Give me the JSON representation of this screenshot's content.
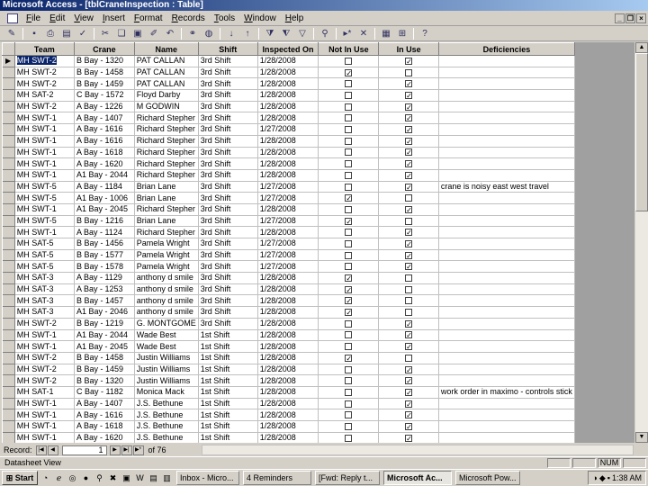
{
  "window": {
    "title": "Microsoft Access - [tblCraneInspection : Table]"
  },
  "menu": [
    "File",
    "Edit",
    "View",
    "Insert",
    "Format",
    "Records",
    "Tools",
    "Window",
    "Help"
  ],
  "toolbar_icons": [
    "design-view-icon",
    "save-icon",
    "print-icon",
    "print-preview-icon",
    "spelling-icon",
    "cut-icon",
    "copy-icon",
    "paste-icon",
    "format-painter-icon",
    "undo-icon",
    "insert-hyperlink-icon",
    "web-toolbar-icon",
    "sort-ascending-icon",
    "sort-descending-icon",
    "filter-by-selection-icon",
    "filter-by-form-icon",
    "apply-filter-icon",
    "find-icon",
    "new-record-icon",
    "delete-record-icon",
    "database-window-icon",
    "new-object-icon",
    "help-icon"
  ],
  "columns": [
    "Team",
    "Crane",
    "Name",
    "Shift",
    "Inspected On",
    "Not In Use",
    "In Use",
    "Deficiencies"
  ],
  "rows": [
    [
      "MH SWT-2",
      "B Bay - 1320",
      "PAT CALLAN",
      "3rd Shift",
      "1/28/2008",
      false,
      true,
      ""
    ],
    [
      "MH SWT-2",
      "B Bay - 1458",
      "PAT CALLAN",
      "3rd Shift",
      "1/28/2008",
      true,
      false,
      ""
    ],
    [
      "MH SWT-2",
      "B Bay - 1459",
      "PAT CALLAN",
      "3rd Shift",
      "1/28/2008",
      false,
      true,
      ""
    ],
    [
      "MH SAT-2",
      "C Bay - 1572",
      "Floyd Darby",
      "3rd Shift",
      "1/28/2008",
      false,
      true,
      ""
    ],
    [
      "MH SWT-2",
      "A Bay - 1226",
      "M GODWIN",
      "3rd Shift",
      "1/28/2008",
      false,
      true,
      ""
    ],
    [
      "MH SWT-1",
      "A Bay - 1407",
      "Richard Stepher",
      "3rd Shift",
      "1/28/2008",
      false,
      true,
      ""
    ],
    [
      "MH SWT-1",
      "A Bay - 1616",
      "Richard Stepher",
      "3rd Shift",
      "1/27/2008",
      false,
      true,
      ""
    ],
    [
      "MH SWT-1",
      "A Bay - 1616",
      "Richard Stepher",
      "3rd Shift",
      "1/28/2008",
      false,
      true,
      ""
    ],
    [
      "MH SWT-1",
      "A Bay - 1618",
      "Richard Stepher",
      "3rd Shift",
      "1/28/2008",
      false,
      true,
      ""
    ],
    [
      "MH SWT-1",
      "A Bay - 1620",
      "Richard Stepher",
      "3rd Shift",
      "1/28/2008",
      false,
      true,
      ""
    ],
    [
      "MH SWT-1",
      "A1 Bay - 2044",
      "Richard Stepher",
      "3rd Shift",
      "1/28/2008",
      false,
      true,
      ""
    ],
    [
      "MH SWT-5",
      "A Bay - 1184",
      "Brian Lane",
      "3rd Shift",
      "1/27/2008",
      false,
      true,
      "crane is noisy east west travel"
    ],
    [
      "MH SWT-5",
      "A1 Bay - 1006",
      "Brian Lane",
      "3rd Shift",
      "1/27/2008",
      true,
      false,
      ""
    ],
    [
      "MH SWT-1",
      "A1 Bay - 2045",
      "Richard Stepher",
      "3rd Shift",
      "1/28/2008",
      false,
      true,
      ""
    ],
    [
      "MH SWT-5",
      "B Bay - 1216",
      "Brian Lane",
      "3rd Shift",
      "1/27/2008",
      true,
      false,
      ""
    ],
    [
      "MH SWT-1",
      "A Bay - 1124",
      "Richard Stepher",
      "3rd Shift",
      "1/28/2008",
      false,
      true,
      ""
    ],
    [
      "MH SAT-5",
      "B Bay - 1456",
      "Pamela Wright",
      "3rd Shift",
      "1/27/2008",
      false,
      true,
      ""
    ],
    [
      "MH SAT-5",
      "B Bay - 1577",
      "Pamela Wright",
      "3rd Shift",
      "1/27/2008",
      false,
      true,
      ""
    ],
    [
      "MH SAT-5",
      "B Bay - 1578",
      "Pamela Wright",
      "3rd Shift",
      "1/27/2008",
      false,
      true,
      ""
    ],
    [
      "MH SAT-3",
      "A Bay - 1129",
      "anthony d smile",
      "3rd Shift",
      "1/28/2008",
      true,
      false,
      ""
    ],
    [
      "MH SAT-3",
      "A Bay - 1253",
      "anthony d smile",
      "3rd Shift",
      "1/28/2008",
      true,
      false,
      ""
    ],
    [
      "MH SAT-3",
      "B Bay - 1457",
      "anthony d smile",
      "3rd Shift",
      "1/28/2008",
      true,
      false,
      ""
    ],
    [
      "MH SAT-3",
      "A1 Bay - 2046",
      "anthony d smile",
      "3rd Shift",
      "1/28/2008",
      true,
      false,
      ""
    ],
    [
      "MH SWT-2",
      "B Bay - 1219",
      "G. MONTGOME",
      "3rd Shift",
      "1/28/2008",
      false,
      true,
      ""
    ],
    [
      "MH SWT-1",
      "A1 Bay - 2044",
      "Wade Best",
      "1st Shift",
      "1/28/2008",
      false,
      true,
      ""
    ],
    [
      "MH SWT-1",
      "A1 Bay - 2045",
      "Wade Best",
      "1st Shift",
      "1/28/2008",
      false,
      true,
      ""
    ],
    [
      "MH SWT-2",
      "B Bay - 1458",
      "Justin Williams",
      "1st Shift",
      "1/28/2008",
      true,
      false,
      ""
    ],
    [
      "MH SWT-2",
      "B Bay - 1459",
      "Justin Williams",
      "1st Shift",
      "1/28/2008",
      false,
      true,
      ""
    ],
    [
      "MH SWT-2",
      "B Bay - 1320",
      "Justin Williams",
      "1st Shift",
      "1/28/2008",
      false,
      true,
      ""
    ],
    [
      "MH SAT-1",
      "C Bay - 1182",
      "Monica Mack",
      "1st Shift",
      "1/28/2008",
      false,
      true,
      "work order in maximo - controls stick"
    ],
    [
      "MH SWT-1",
      "A Bay - 1407",
      "J.S. Bethune",
      "1st Shift",
      "1/28/2008",
      false,
      true,
      ""
    ],
    [
      "MH SWT-1",
      "A Bay - 1616",
      "J.S. Bethune",
      "1st Shift",
      "1/28/2008",
      false,
      true,
      ""
    ],
    [
      "MH SWT-1",
      "A Bay - 1618",
      "J.S. Bethune",
      "1st Shift",
      "1/28/2008",
      false,
      true,
      ""
    ],
    [
      "MH SWT-1",
      "A Bay - 1620",
      "J.S. Bethune",
      "1st Shift",
      "1/28/2008",
      false,
      true,
      ""
    ]
  ],
  "navigator": {
    "label": "Record:",
    "current": "1",
    "of_label": "of 76"
  },
  "status": {
    "text": "Datasheet View",
    "num": "NUM"
  },
  "taskbar": {
    "start": "Start",
    "tasks": [
      "Inbox - Micro...",
      "4 Reminders",
      "[Fwd: Reply t...",
      "Microsoft Ac...",
      "Microsoft Pow..."
    ],
    "active_index": 3,
    "clock": "1:38 AM"
  }
}
